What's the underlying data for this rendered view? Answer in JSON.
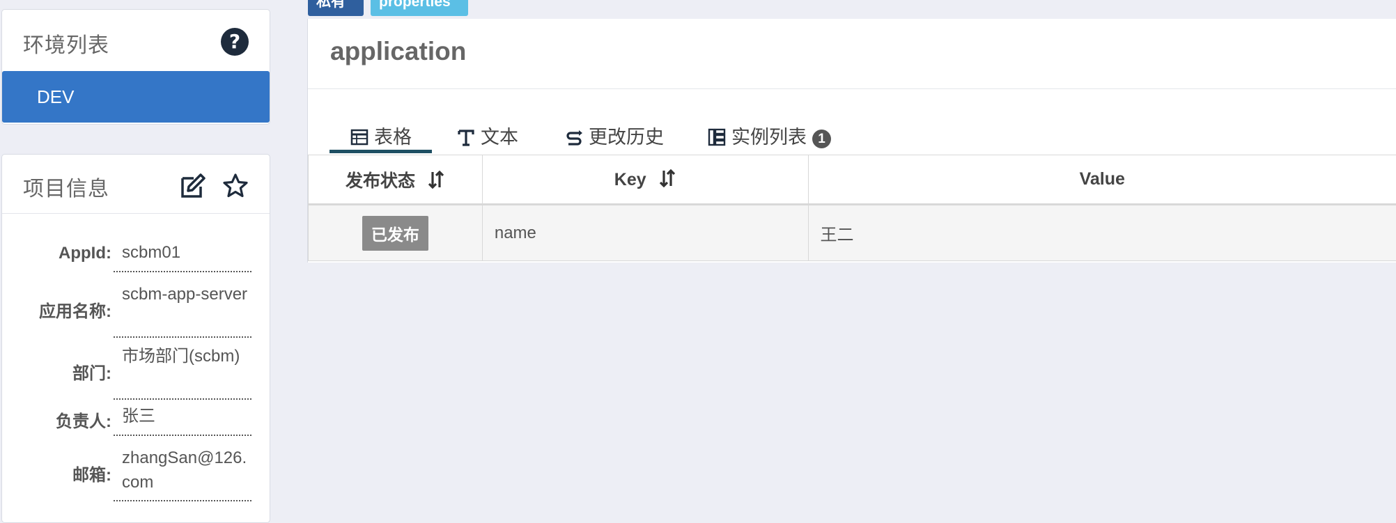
{
  "env_panel": {
    "title": "环境列表",
    "environments": [
      {
        "label": "DEV"
      }
    ]
  },
  "project_panel": {
    "title": "项目信息",
    "rows": [
      {
        "label": "AppId:",
        "value": "scbm01"
      },
      {
        "label": "应用名称:",
        "value": "scbm-app-server"
      },
      {
        "label": "部门:",
        "value": "市场部门(scbm)"
      },
      {
        "label": "负责人:",
        "value": "张三"
      },
      {
        "label": "邮箱:",
        "value": "zhangSan@126.com"
      }
    ]
  },
  "namespace": {
    "badges": {
      "private": "私有",
      "format": "properties"
    },
    "title": "application",
    "tabs": [
      {
        "label": "表格",
        "icon": "table-icon"
      },
      {
        "label": "文本",
        "icon": "text-icon"
      },
      {
        "label": "更改历史",
        "icon": "history-icon"
      },
      {
        "label": "实例列表",
        "icon": "instance-list-icon",
        "count": "1"
      }
    ],
    "table": {
      "headers": {
        "status": "发布状态",
        "key": "Key",
        "value": "Value"
      },
      "rows": [
        {
          "status": "已发布",
          "key": "name",
          "value": "王二"
        }
      ]
    }
  },
  "colors": {
    "accent": "#3476c7",
    "background": "#edeef5",
    "private_badge": "#2f5f9e",
    "format_badge": "#5bbfe5",
    "tab_underline": "#1e4f63",
    "status_tag": "#8a8a8a"
  }
}
